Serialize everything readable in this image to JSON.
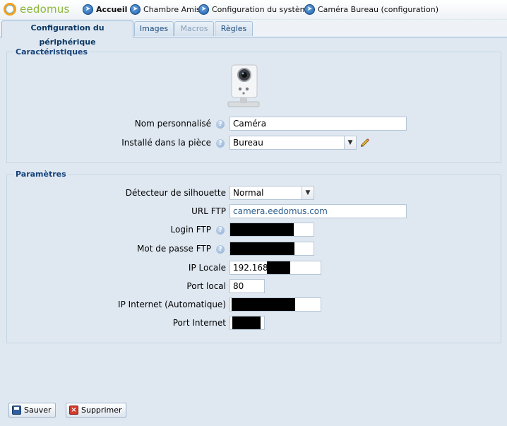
{
  "header": {
    "logo_text": "eedomus",
    "breadcrumbs": [
      {
        "label": "Accueil",
        "bold": true
      },
      {
        "label": "Chambre Amis"
      },
      {
        "label": "Configuration du système"
      },
      {
        "label": "Caméra Bureau (configuration)"
      }
    ]
  },
  "tabs": [
    {
      "label": "Configuration du périphérique",
      "state": "active"
    },
    {
      "label": "Images",
      "state": "normal"
    },
    {
      "label": "Macros",
      "state": "disabled"
    },
    {
      "label": "Règles",
      "state": "normal"
    }
  ],
  "characteristics": {
    "legend": "Caractéristiques",
    "name_label": "Nom personnalisé",
    "name_value": "Caméra",
    "room_label": "Installé dans la pièce",
    "room_value": "Bureau"
  },
  "parameters": {
    "legend": "Paramètres",
    "silhouette_label": "Détecteur de silhouette",
    "silhouette_value": "Normal",
    "ftp_url_label": "URL FTP",
    "ftp_url_value": "camera.eedomus.com",
    "ftp_login_label": "Login FTP",
    "ftp_password_label": "Mot de passe FTP",
    "local_ip_label": "IP Locale",
    "local_ip_value": "192.168",
    "local_port_label": "Port local",
    "local_port_value": "80",
    "internet_ip_label": "IP Internet (Automatique)",
    "internet_port_label": "Port Internet"
  },
  "buttons": {
    "save_label": "Sauver",
    "delete_label": "Supprimer"
  },
  "icons": {
    "help": "help-icon",
    "edit": "pencil-icon",
    "nav": "arrow-circle-icon"
  }
}
